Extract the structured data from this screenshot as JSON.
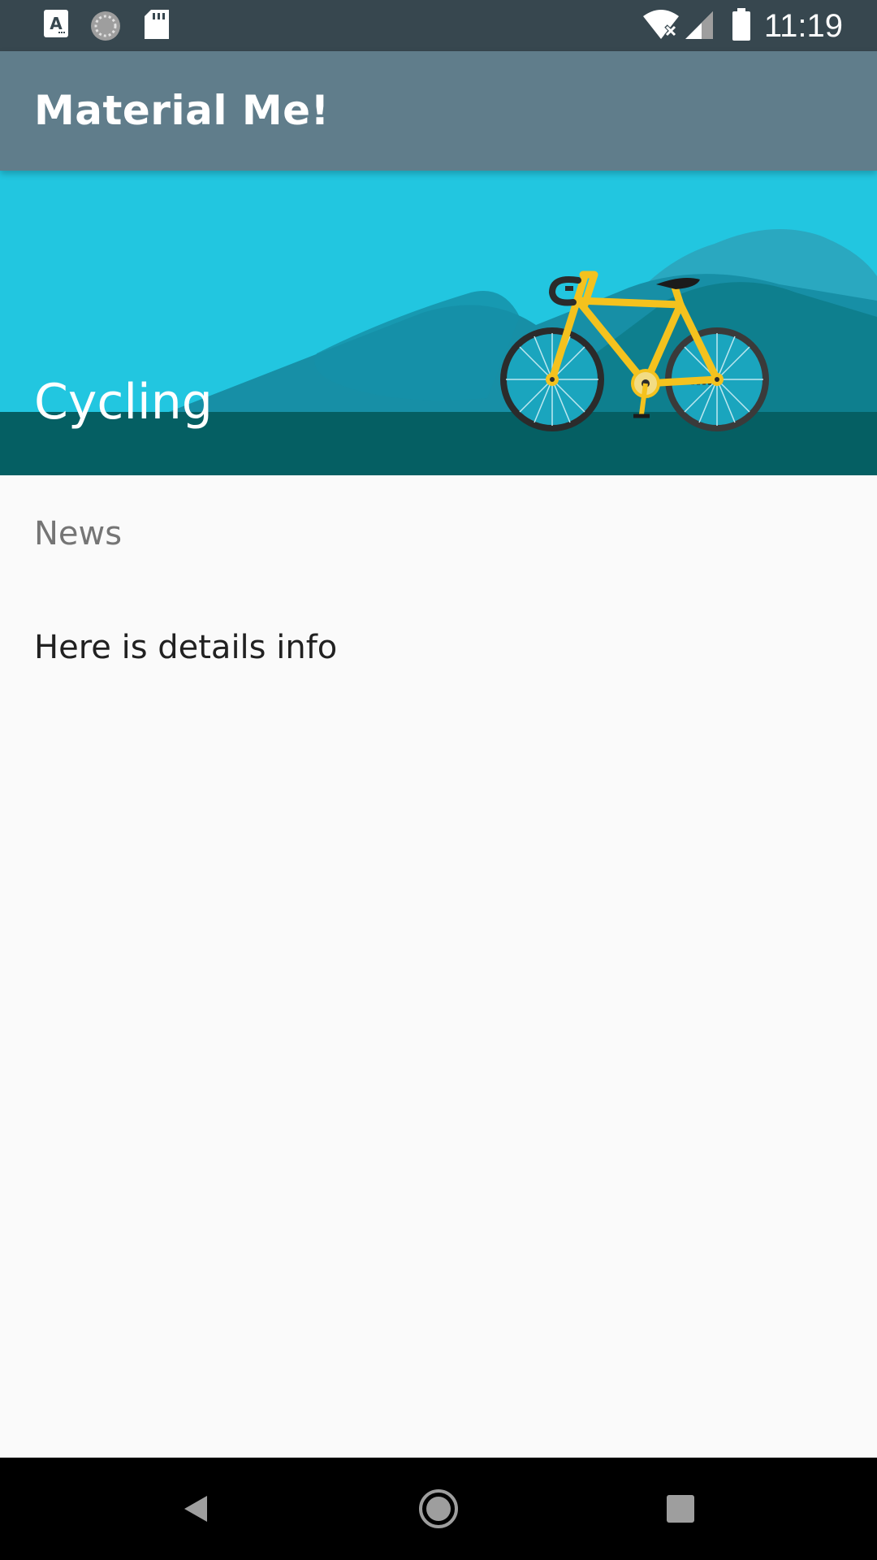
{
  "status_bar": {
    "time": "11:19",
    "left_icons": [
      "accessibility-a-icon",
      "sync-circle-icon",
      "sd-card-icon"
    ],
    "right_icons": [
      "wifi-off-icon",
      "cell-signal-icon",
      "battery-icon"
    ]
  },
  "app_bar": {
    "title": "Material Me!"
  },
  "header": {
    "title": "Cycling"
  },
  "content": {
    "subtitle": "News",
    "details": "Here is details info"
  },
  "nav_bar": {
    "icons": [
      "back-icon",
      "home-icon",
      "recents-icon"
    ]
  },
  "colors": {
    "status_bar": "#37474F",
    "app_bar": "#607D8B",
    "sky": "#22C6E0",
    "ground": "#055F63",
    "background": "#FAFAFA",
    "bike_frame": "#F4C21E"
  }
}
